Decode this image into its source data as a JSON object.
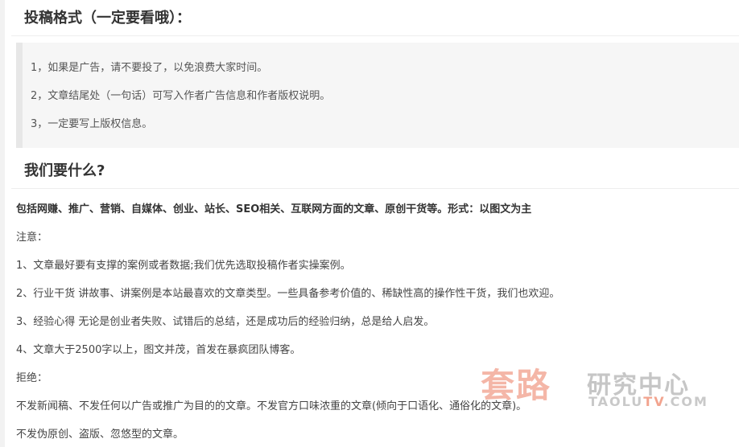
{
  "section1": {
    "heading": "投稿格式（一定要看哦）：",
    "items": [
      "1，如果是广告，请不要投了，以免浪费大家时间。",
      "2，文章结尾处（一句话）可写入作者广告信息和作者版权说明。",
      "3，一定要写上版权信息。"
    ]
  },
  "section2": {
    "heading": "我们要什么?",
    "intro": "包括网赚、推广、营销、自媒体、创业、站长、SEO相关、互联网方面的文章、原创干货等。形式：以图文为主",
    "note_label": "注意：",
    "notes": [
      "1、文章最好要有支撑的案例或者数据;我们优先选取投稿作者实操案例。",
      "2、行业干货 讲故事、讲案例是本站最喜欢的文章类型。一些具备参考价值的、稀缺性高的操作性干货，我们也欢迎。",
      "3、经验心得 无论是创业者失败、试错后的总结，还是成功后的经验归纳，总是给人启发。",
      "4、文章大于2500字以上，图文并茂，首发在暴疯团队博客。"
    ],
    "reject_label": "拒绝：",
    "rejects": [
      "不发新闻稿、不发任何以广告或推广为目的的文章。不发官方口味浓重的文章(倾向于口语化、通俗化的文章)。",
      "不发伪原创、盗版、忽悠型的文章。"
    ]
  },
  "watermark": {
    "cn": "套路",
    "sub": "研究中心",
    "en_prefix": "TAOLU",
    "en_accent": "TV",
    "en_suffix": ".COM"
  },
  "colors": {
    "heading": "#333333",
    "body_text": "#444444",
    "quote_bg": "#f6f6f6",
    "quote_border": "#e7e7e7",
    "watermark_red": "#f19a86"
  }
}
